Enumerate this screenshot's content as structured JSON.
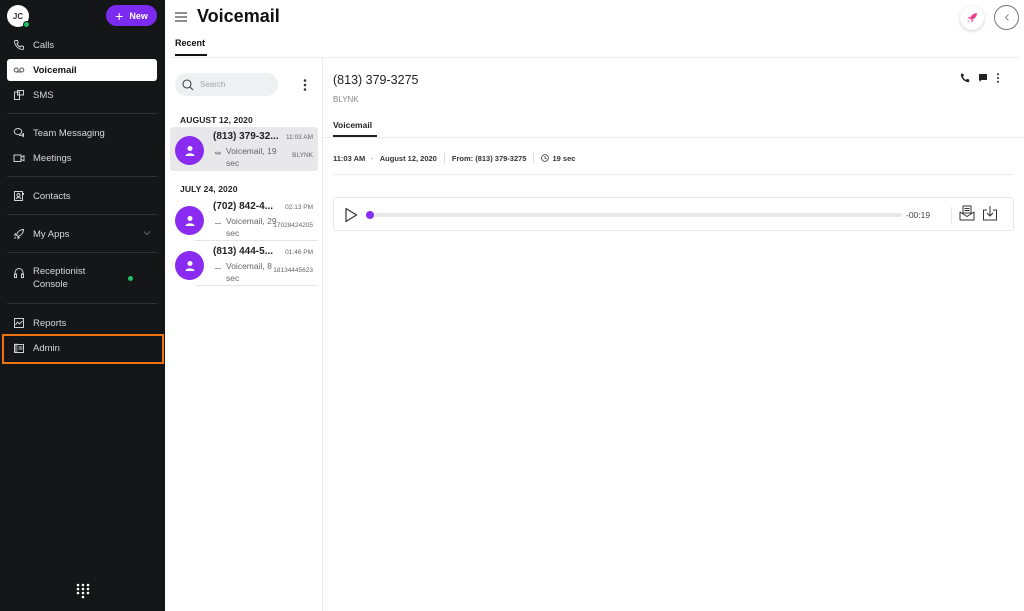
{
  "user": {
    "initials": "JC",
    "status_color": "#1fbf6a"
  },
  "new_button": {
    "label": "New",
    "color": "#7b2bf0"
  },
  "sidebar": {
    "items": [
      {
        "id": "calls",
        "label": "Calls",
        "icon": "phone-icon"
      },
      {
        "id": "voicemail",
        "label": "Voicemail",
        "icon": "voicemail-icon",
        "active": true
      },
      {
        "id": "sms",
        "label": "SMS",
        "icon": "sms-icon"
      },
      {
        "id": "team-messaging",
        "label": "Team Messaging",
        "icon": "chat-bubbles-icon"
      },
      {
        "id": "meetings",
        "label": "Meetings",
        "icon": "video-icon"
      },
      {
        "id": "contacts",
        "label": "Contacts",
        "icon": "contacts-icon"
      },
      {
        "id": "my-apps",
        "label": "My Apps",
        "icon": "rocket-icon",
        "expandable": true
      },
      {
        "id": "receptionist-console",
        "label": "Receptionist Console",
        "icon": "headset-icon",
        "status": "online"
      },
      {
        "id": "reports",
        "label": "Reports",
        "icon": "chart-icon"
      },
      {
        "id": "admin",
        "label": "Admin",
        "icon": "admin-icon",
        "highlighted": true
      }
    ],
    "highlight_color": "#f07313"
  },
  "header": {
    "title": "Voicemail",
    "tabs": [
      {
        "label": "Recent",
        "active": true
      }
    ]
  },
  "list": {
    "search_placeholder": "Search",
    "groups": [
      {
        "date": "AUGUST 12, 2020",
        "items": [
          {
            "name": "(813) 379-32...",
            "time": "11:03 AM",
            "subtitle": "Voicemail, 19 sec",
            "from": "BLYNK",
            "selected": true
          }
        ]
      },
      {
        "date": "JULY 24, 2020",
        "items": [
          {
            "name": "(702) 842-4...",
            "time": "02:13 PM",
            "subtitle": "Voicemail, 29 sec",
            "from": "17028424205"
          },
          {
            "name": "(813) 444-5...",
            "time": "01:46 PM",
            "subtitle": "Voicemail, 8 sec",
            "from": "18134445623"
          }
        ]
      }
    ]
  },
  "detail": {
    "number": "(813) 379-3275",
    "company": "BLYNK",
    "tab": "Voicemail",
    "meta": {
      "time": "11:03 AM",
      "date": "August 12, 2020",
      "from": "From: (813) 379-3275",
      "duration": "19 sec"
    },
    "player": {
      "remaining": "-00:19",
      "progress_fraction": 0.0
    }
  },
  "colors": {
    "accent": "#8a2bf2",
    "rocket": "#e8408a"
  }
}
